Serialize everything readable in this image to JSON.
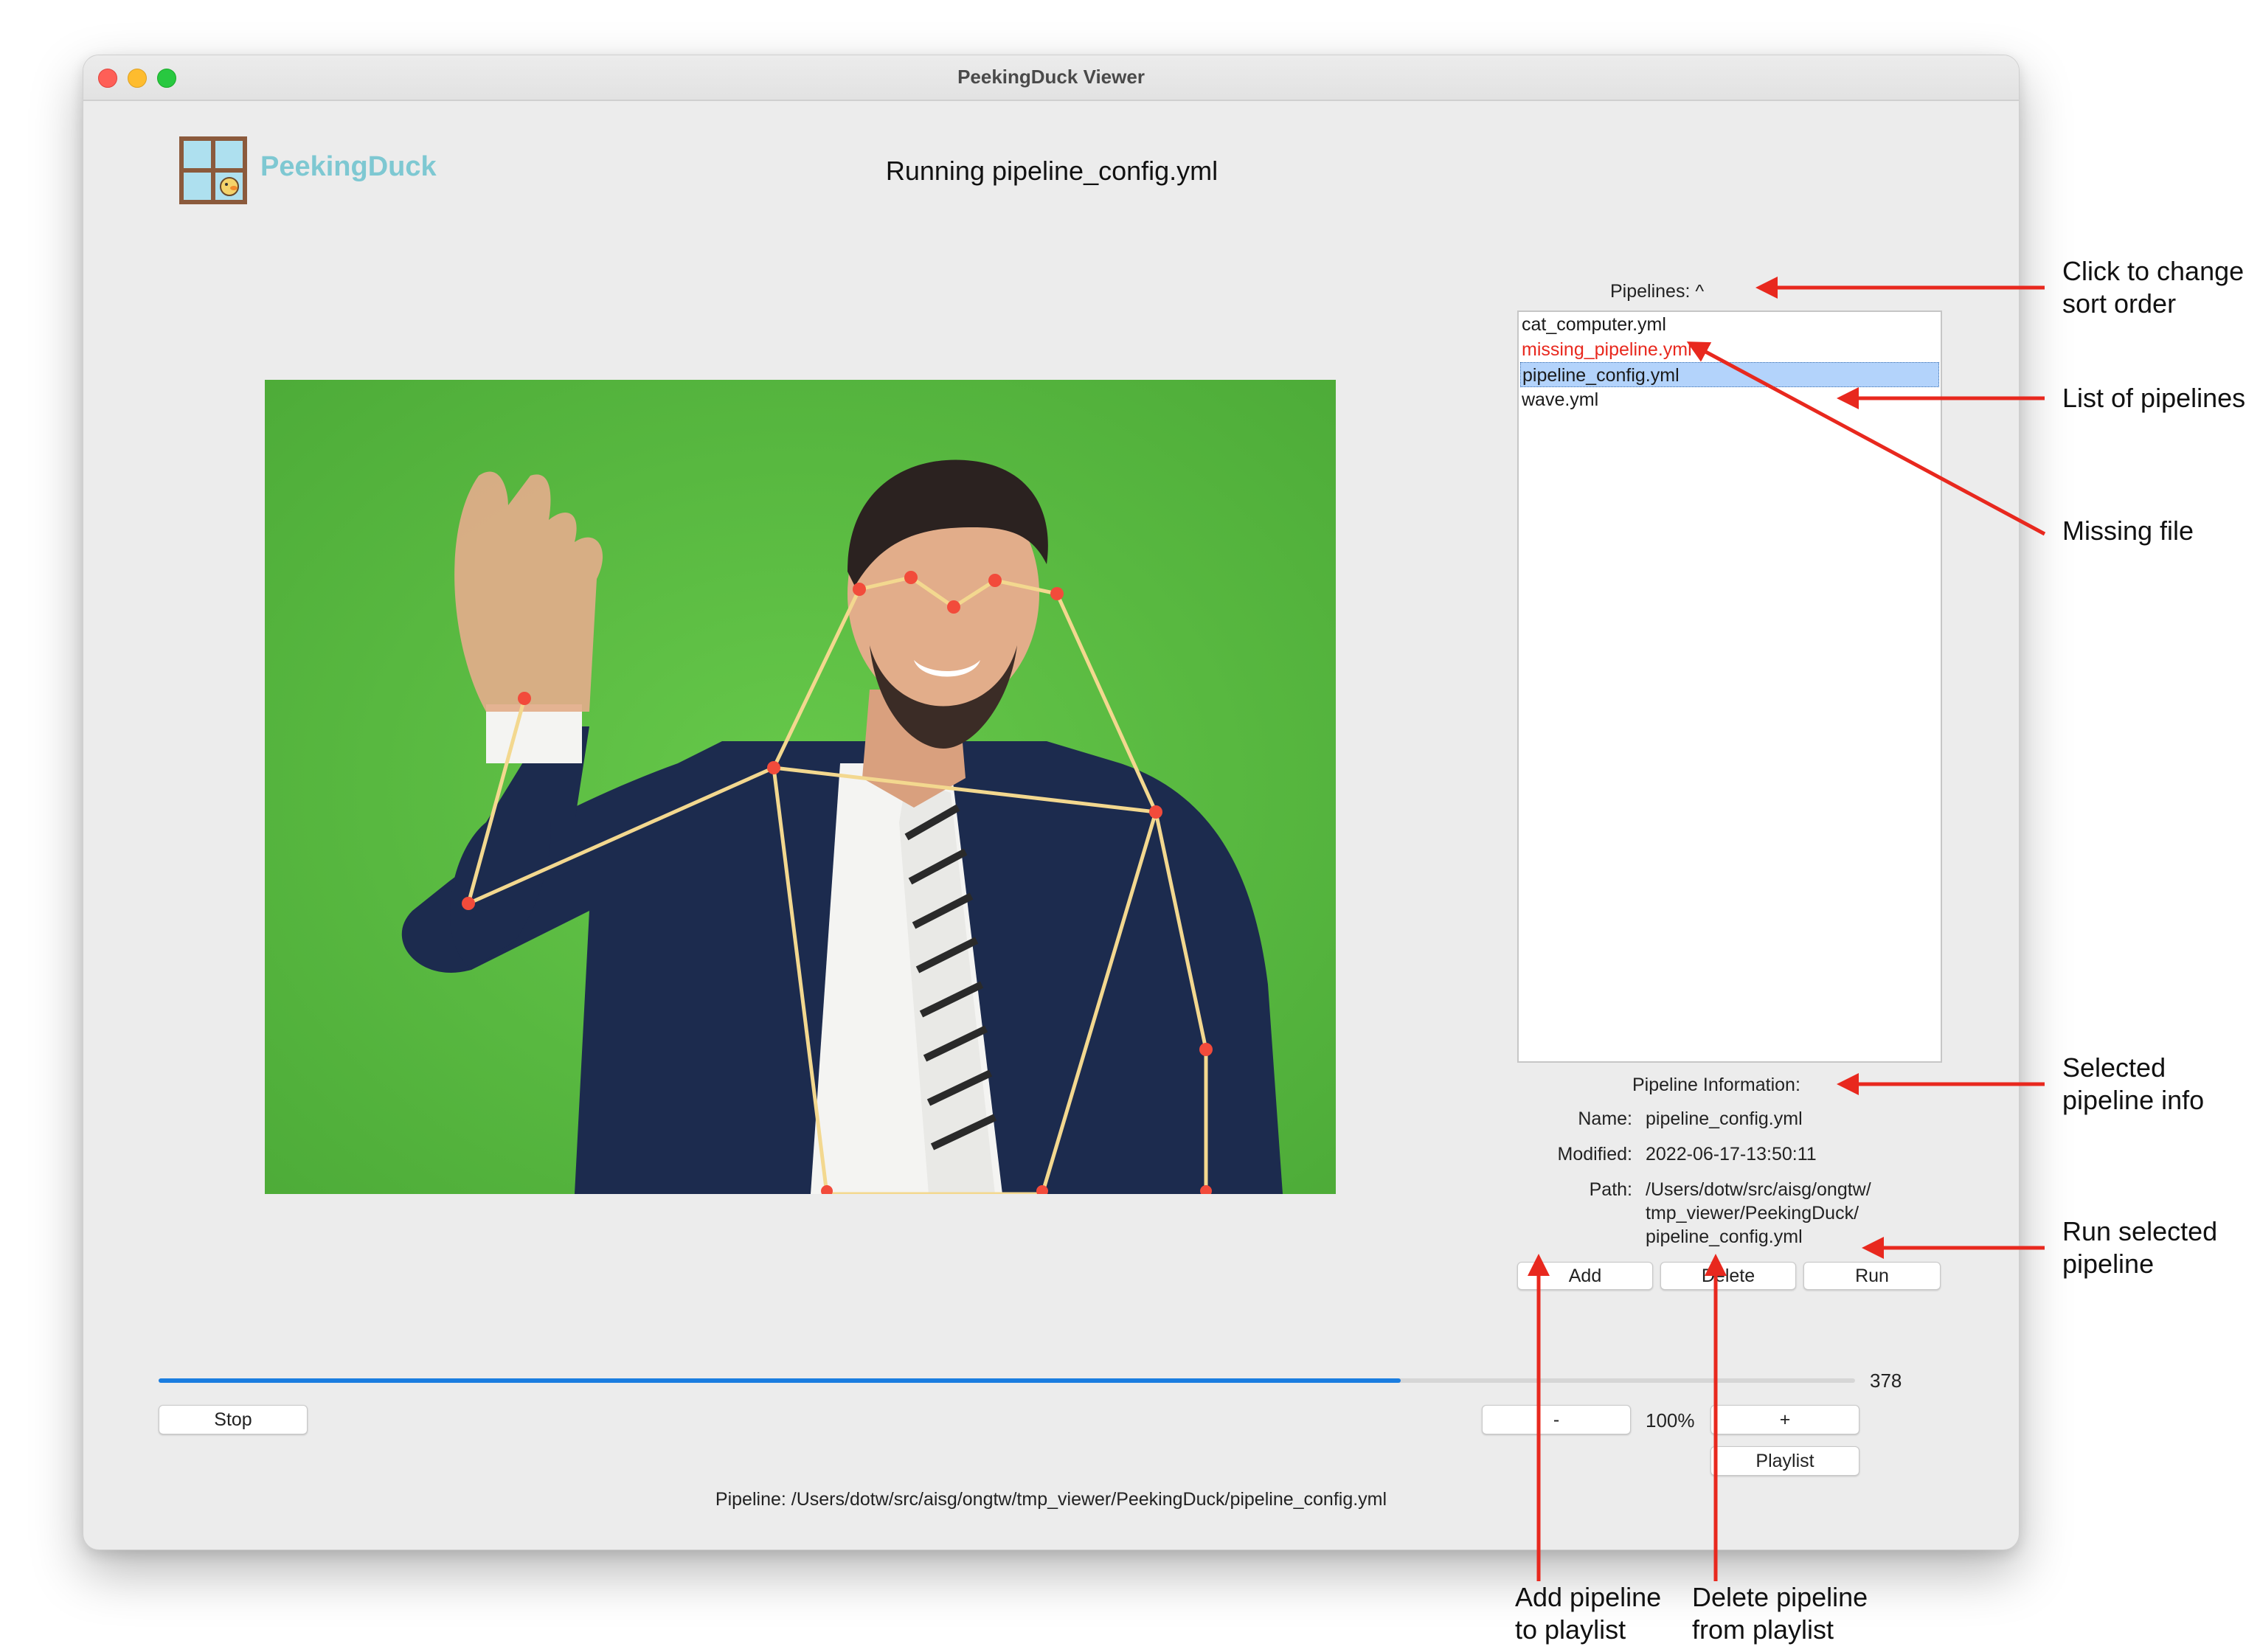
{
  "window": {
    "title": "PeekingDuck Viewer"
  },
  "header": {
    "logo_text": "PeekingDuck",
    "running_label": "Running pipeline_config.yml"
  },
  "pipelines": {
    "header_label": "Pipelines: ^",
    "items": [
      {
        "label": "cat_computer.yml",
        "state": "normal"
      },
      {
        "label": "missing_pipeline.yml",
        "state": "missing"
      },
      {
        "label": "pipeline_config.yml",
        "state": "selected"
      },
      {
        "label": "wave.yml",
        "state": "normal"
      }
    ]
  },
  "info": {
    "heading": "Pipeline Information:",
    "name_label": "Name:",
    "name_value": "pipeline_config.yml",
    "modified_label": "Modified:",
    "modified_value": "2022-06-17-13:50:11",
    "path_label": "Path:",
    "path_lines": [
      "/Users/dotw/src/aisg/ongtw/",
      "tmp_viewer/PeekingDuck/",
      "pipeline_config.yml"
    ]
  },
  "buttons": {
    "add": "Add",
    "delete": "Delete",
    "run": "Run",
    "stop": "Stop",
    "zoom_out": "-",
    "zoom_in": "+",
    "playlist": "Playlist"
  },
  "playback": {
    "frame_count": "378",
    "progress_fraction": 0.732,
    "zoom": "100%"
  },
  "footer": {
    "pipeline_path": "Pipeline: /Users/dotw/src/aisg/ongtw/tmp_viewer/PeekingDuck/pipeline_config.yml"
  },
  "annotations": {
    "sort_order": [
      "Click to change",
      "sort order"
    ],
    "list": [
      "List of pipelines"
    ],
    "missing": [
      "Missing file"
    ],
    "selected_info": [
      "Selected",
      "pipeline info"
    ],
    "run_selected": [
      "Run selected",
      "pipeline"
    ],
    "add_pipeline": [
      "Add pipeline",
      "to playlist"
    ],
    "delete_pipeline": [
      "Delete pipeline",
      "from playlist"
    ]
  },
  "colors": {
    "missing_text": "#e8281e",
    "selected_bg": "#b3d3fb",
    "progress": "#1a7de0",
    "annotation_arrow": "#e8281e",
    "logo_text": "#7ec8d2",
    "video_background": "#5bbd42",
    "skeleton_line": "#f3d88f",
    "keypoint": "#f24b3b"
  }
}
